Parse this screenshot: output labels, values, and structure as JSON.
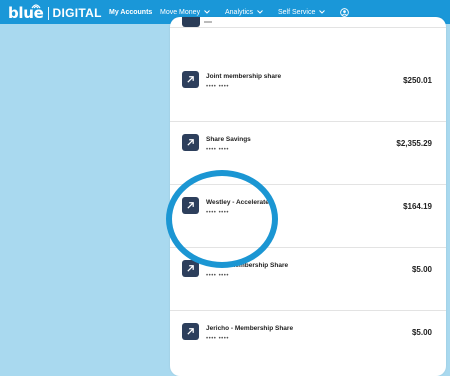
{
  "brand": {
    "name": "blue",
    "product": "DIGITAL"
  },
  "nav": {
    "items": [
      {
        "label": "My Accounts",
        "icon": ""
      },
      {
        "label": "Move Money",
        "icon": "chevron-down-icon"
      },
      {
        "label": "Analytics",
        "icon": "chevron-down-icon"
      },
      {
        "label": "Self Service",
        "icon": "chevron-down-icon"
      }
    ],
    "user_icon": "user-icon"
  },
  "accounts": [
    {
      "name": "Joint membership share",
      "masked": "•••• ••••",
      "amount": "$250.01"
    },
    {
      "name": "Share Savings",
      "masked": "•••• ••••",
      "amount": "$2,355.29"
    },
    {
      "name": "Westley - Accelerate",
      "masked": "•••• ••••",
      "amount": "$164.19"
    },
    {
      "name": "- Membership Share",
      "masked": "•••• ••••",
      "amount": "$5.00"
    },
    {
      "name": "Jericho - Membership Share",
      "masked": "•••• ••••",
      "amount": "$5.00"
    }
  ],
  "colors": {
    "topbar": "#1a97d8",
    "background": "#a9d9ef",
    "icon_bg": "#2d3f5c",
    "highlight": "#1b96d3"
  }
}
